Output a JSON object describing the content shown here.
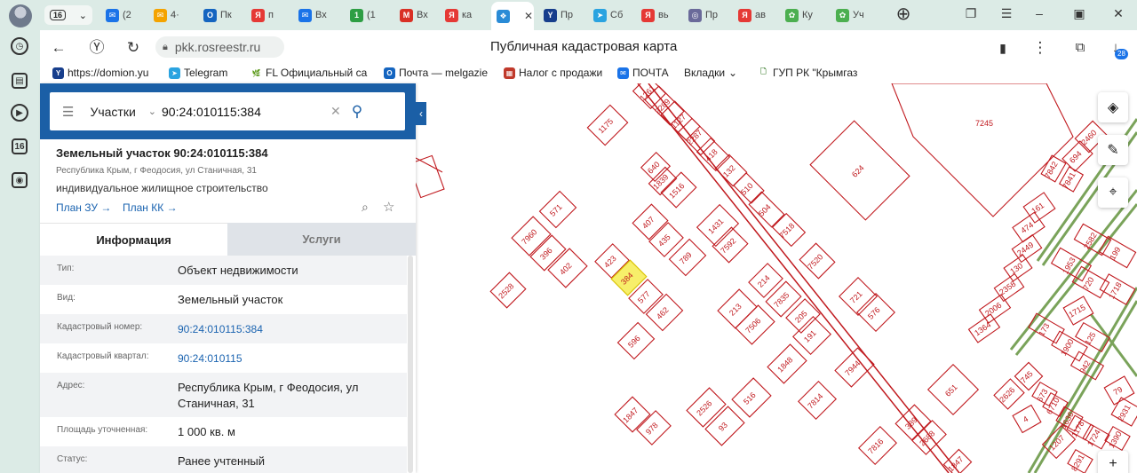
{
  "browser": {
    "tab_counter": "16",
    "tabs": [
      {
        "label": "(2",
        "color": "#1a73e8",
        "glyph": "✉"
      },
      {
        "label": "4·",
        "color": "#f4a300",
        "glyph": "✉"
      },
      {
        "label": "Пк",
        "color": "#1565c0",
        "glyph": "O"
      },
      {
        "label": "п",
        "color": "#e53935",
        "glyph": "Я"
      },
      {
        "label": "Вх",
        "color": "#1a73e8",
        "glyph": "✉"
      },
      {
        "label": "(1",
        "color": "#2e9e44",
        "glyph": "1"
      },
      {
        "label": "Вх",
        "color": "#d93025",
        "glyph": "M"
      },
      {
        "label": "ка",
        "color": "#e53935",
        "glyph": "Я"
      },
      {
        "label": "",
        "color": "#2a8bd6",
        "glyph": "❖"
      },
      {
        "label": "Пр",
        "color": "#173e8c",
        "glyph": "Y"
      },
      {
        "label": "Сб",
        "color": "#2aa3e0",
        "glyph": "➤"
      },
      {
        "label": "вь",
        "color": "#e53935",
        "glyph": "Я"
      },
      {
        "label": "Пр",
        "color": "#6a6a9a",
        "glyph": "◎"
      },
      {
        "label": "ав",
        "color": "#e53935",
        "glyph": "Я"
      },
      {
        "label": "Ку",
        "color": "#4caf50",
        "glyph": "✿"
      },
      {
        "label": "Уч",
        "color": "#4caf50",
        "glyph": "✿"
      }
    ],
    "url": "pkk.rosreestr.ru",
    "page_title": "Публичная кадастровая карта",
    "downloads_badge": "28"
  },
  "bookmarks": [
    {
      "label": "https://domion.yu",
      "color": "#173e8c",
      "glyph": "Y"
    },
    {
      "label": "Telegram",
      "color": "#2aa3e0",
      "glyph": "➤"
    },
    {
      "label": "FL  Официальный са",
      "color": "#ffffff",
      "glyph": "🌿"
    },
    {
      "label": "Почта — melgazie",
      "color": "#1565c0",
      "glyph": "O"
    },
    {
      "label": "Налог с продажи",
      "color": "#c0392b",
      "glyph": "▦"
    },
    {
      "label": "ПОЧТА",
      "color": "#1a73e8",
      "glyph": "✉"
    },
    {
      "label": "Вкладки",
      "color": "",
      "glyph": ""
    },
    {
      "label": "ГУП РК \"Крымгаз",
      "color": "",
      "glyph": "🗋"
    }
  ],
  "search": {
    "mode": "Участки",
    "query": "90:24:010115:384"
  },
  "object": {
    "title": "Земельный участок 90:24:010115:384",
    "address_short": "Республика Крым, г Феодосия, ул Станичная, 31",
    "usage": "индивидуальное жилищное строительство",
    "plan_zu": "План ЗУ →",
    "plan_kk": "План КК →"
  },
  "tabs": {
    "info": "Информация",
    "services": "Услуги"
  },
  "info_rows": [
    {
      "key": "Тип:",
      "value": "Объект недвижимости",
      "link": false
    },
    {
      "key": "Вид:",
      "value": "Земельный участок",
      "link": false
    },
    {
      "key": "Кадастровый номер:",
      "value": "90:24:010115:384",
      "link": true
    },
    {
      "key": "Кадастровый квартал:",
      "value": "90:24:010115",
      "link": true
    },
    {
      "key": "Адрес:",
      "value": "Республика Крым, г Феодосия, ул Станичная, 31",
      "link": false
    },
    {
      "key": "Площадь уточненная:",
      "value": "1 000 кв. м",
      "link": false
    },
    {
      "key": "Статус:",
      "value": "Ранее учтенный",
      "link": false
    }
  ],
  "map": {
    "parcel_color": "#c0191e",
    "selected_fill": "#f7ef6a",
    "road_color": "#7aa35a",
    "selected_parcel": "384",
    "parcel_labels": [
      "1261",
      "2289",
      "1127",
      "2287",
      "418",
      "132",
      "510",
      "504",
      "7518",
      "1175",
      "640",
      "1839",
      "1516",
      "407",
      "435",
      "1431",
      "789",
      "7592",
      "571",
      "7960",
      "396",
      "402",
      "2528",
      "423",
      "384",
      "577",
      "462",
      "596",
      "214",
      "213",
      "7835",
      "7506",
      "205",
      "191",
      "1848",
      "7944",
      "7814",
      "721",
      "576",
      "7520",
      "624",
      "651",
      "2526",
      "93",
      "516",
      "1847",
      "978",
      "389",
      "2688",
      "7816",
      "7245",
      "2460",
      "694",
      "7842",
      "7841",
      "161",
      "474",
      "2449",
      "130",
      "2358",
      "2006",
      "1364",
      "1953",
      "2582",
      "720",
      "199",
      "1715",
      "1718",
      "173",
      "1900",
      "125",
      "942",
      "79",
      "2626",
      "745",
      "673",
      "6710",
      "1636",
      "1178",
      "4",
      "1207",
      "2931",
      "1724",
      "8291",
      "1390",
      "1847"
    ]
  }
}
